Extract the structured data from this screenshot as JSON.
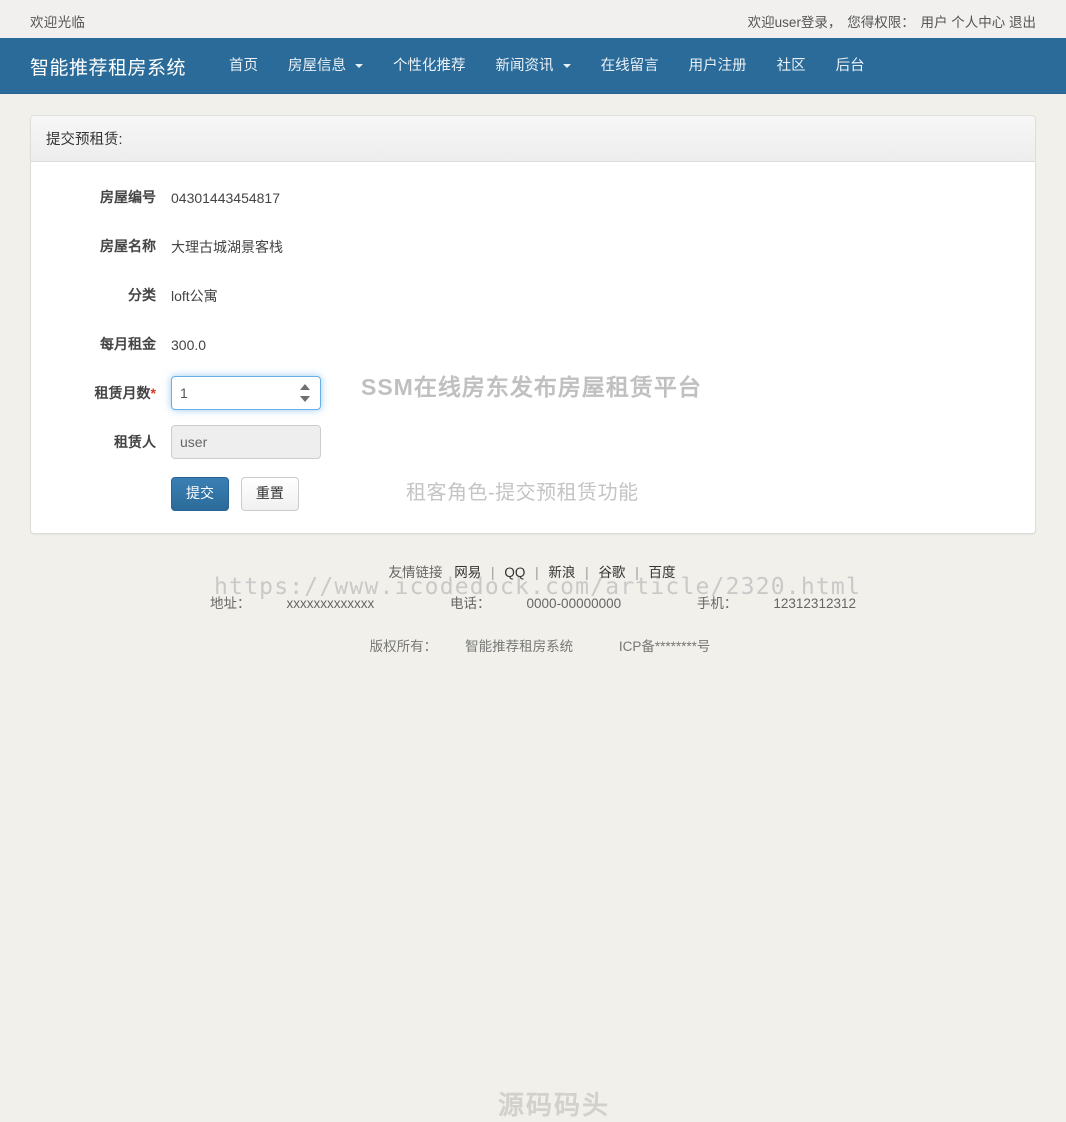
{
  "topbar": {
    "welcome": "欢迎光临",
    "login_text": "欢迎user登录，",
    "role_label": "您得权限：",
    "role_value": "用户",
    "profile_link": "个人中心",
    "logout_link": "退出"
  },
  "navbar": {
    "brand": "智能推荐租房系统",
    "items": [
      {
        "label": "首页",
        "caret": false
      },
      {
        "label": "房屋信息",
        "caret": true
      },
      {
        "label": "个性化推荐",
        "caret": false
      },
      {
        "label": "新闻资讯",
        "caret": true
      },
      {
        "label": "在线留言",
        "caret": false
      },
      {
        "label": "用户注册",
        "caret": false
      },
      {
        "label": "社区",
        "caret": false
      },
      {
        "label": "后台",
        "caret": false
      }
    ],
    "background_color": "#2b6b99"
  },
  "panel": {
    "heading": "提交预租赁:",
    "fields": [
      {
        "label": "房屋编号",
        "value": "04301443454817"
      },
      {
        "label": "房屋名称",
        "value": "大理古城湖景客栈"
      },
      {
        "label": "分类",
        "value": "loft公寓"
      },
      {
        "label": "每月租金",
        "value": "300.0"
      }
    ],
    "months": {
      "label": "租赁月数",
      "required_mark": "*",
      "value": "1"
    },
    "renter": {
      "label": "租赁人",
      "value": "user"
    },
    "submit_label": "提交",
    "reset_label": "重置"
  },
  "watermarks": {
    "title": "SSM在线房东发布房屋租赁平台",
    "role": "租客角色-提交预租赁功能",
    "url": "https://www.icodedock.com/article/2320.html",
    "logo": "源码码头"
  },
  "footer": {
    "friend_label": "友情链接",
    "links": [
      "网易",
      "QQ",
      "新浪",
      "谷歌",
      "百度"
    ],
    "separator": "|",
    "address_label": "地址：",
    "address_value": "xxxxxxxxxxxxx",
    "phone_label": "电话：",
    "phone_value": "0000-00000000",
    "mobile_label": "手机：",
    "mobile_value": "12312312312",
    "copyright_label": "版权所有：",
    "copyright_value": "智能推荐租房系统",
    "icp": "ICP备********号"
  }
}
